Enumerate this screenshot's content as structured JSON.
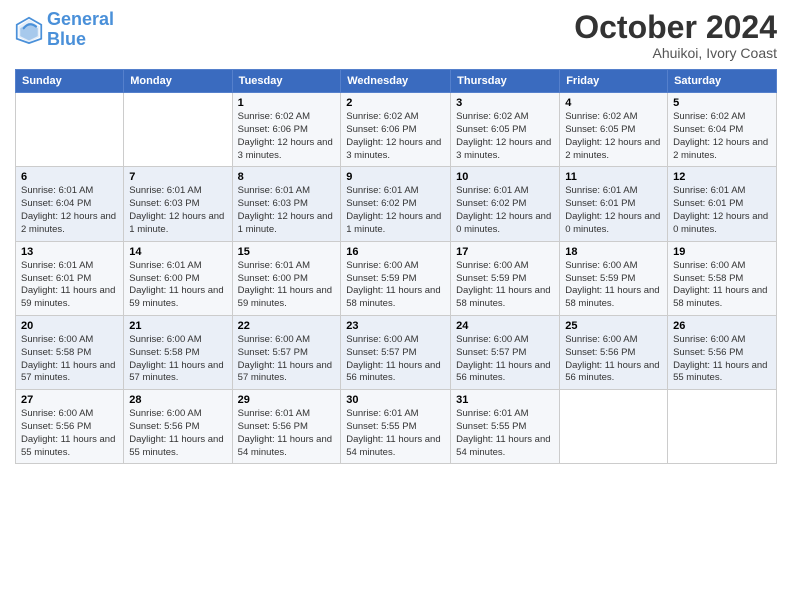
{
  "logo": {
    "line1": "General",
    "line2": "Blue"
  },
  "title": "October 2024",
  "subtitle": "Ahuikoi, Ivory Coast",
  "days_of_week": [
    "Sunday",
    "Monday",
    "Tuesday",
    "Wednesday",
    "Thursday",
    "Friday",
    "Saturday"
  ],
  "weeks": [
    [
      {
        "day": "",
        "info": ""
      },
      {
        "day": "",
        "info": ""
      },
      {
        "day": "1",
        "info": "Sunrise: 6:02 AM\nSunset: 6:06 PM\nDaylight: 12 hours and 3 minutes."
      },
      {
        "day": "2",
        "info": "Sunrise: 6:02 AM\nSunset: 6:06 PM\nDaylight: 12 hours and 3 minutes."
      },
      {
        "day": "3",
        "info": "Sunrise: 6:02 AM\nSunset: 6:05 PM\nDaylight: 12 hours and 3 minutes."
      },
      {
        "day": "4",
        "info": "Sunrise: 6:02 AM\nSunset: 6:05 PM\nDaylight: 12 hours and 2 minutes."
      },
      {
        "day": "5",
        "info": "Sunrise: 6:02 AM\nSunset: 6:04 PM\nDaylight: 12 hours and 2 minutes."
      }
    ],
    [
      {
        "day": "6",
        "info": "Sunrise: 6:01 AM\nSunset: 6:04 PM\nDaylight: 12 hours and 2 minutes."
      },
      {
        "day": "7",
        "info": "Sunrise: 6:01 AM\nSunset: 6:03 PM\nDaylight: 12 hours and 1 minute."
      },
      {
        "day": "8",
        "info": "Sunrise: 6:01 AM\nSunset: 6:03 PM\nDaylight: 12 hours and 1 minute."
      },
      {
        "day": "9",
        "info": "Sunrise: 6:01 AM\nSunset: 6:02 PM\nDaylight: 12 hours and 1 minute."
      },
      {
        "day": "10",
        "info": "Sunrise: 6:01 AM\nSunset: 6:02 PM\nDaylight: 12 hours and 0 minutes."
      },
      {
        "day": "11",
        "info": "Sunrise: 6:01 AM\nSunset: 6:01 PM\nDaylight: 12 hours and 0 minutes."
      },
      {
        "day": "12",
        "info": "Sunrise: 6:01 AM\nSunset: 6:01 PM\nDaylight: 12 hours and 0 minutes."
      }
    ],
    [
      {
        "day": "13",
        "info": "Sunrise: 6:01 AM\nSunset: 6:01 PM\nDaylight: 11 hours and 59 minutes."
      },
      {
        "day": "14",
        "info": "Sunrise: 6:01 AM\nSunset: 6:00 PM\nDaylight: 11 hours and 59 minutes."
      },
      {
        "day": "15",
        "info": "Sunrise: 6:01 AM\nSunset: 6:00 PM\nDaylight: 11 hours and 59 minutes."
      },
      {
        "day": "16",
        "info": "Sunrise: 6:00 AM\nSunset: 5:59 PM\nDaylight: 11 hours and 58 minutes."
      },
      {
        "day": "17",
        "info": "Sunrise: 6:00 AM\nSunset: 5:59 PM\nDaylight: 11 hours and 58 minutes."
      },
      {
        "day": "18",
        "info": "Sunrise: 6:00 AM\nSunset: 5:59 PM\nDaylight: 11 hours and 58 minutes."
      },
      {
        "day": "19",
        "info": "Sunrise: 6:00 AM\nSunset: 5:58 PM\nDaylight: 11 hours and 58 minutes."
      }
    ],
    [
      {
        "day": "20",
        "info": "Sunrise: 6:00 AM\nSunset: 5:58 PM\nDaylight: 11 hours and 57 minutes."
      },
      {
        "day": "21",
        "info": "Sunrise: 6:00 AM\nSunset: 5:58 PM\nDaylight: 11 hours and 57 minutes."
      },
      {
        "day": "22",
        "info": "Sunrise: 6:00 AM\nSunset: 5:57 PM\nDaylight: 11 hours and 57 minutes."
      },
      {
        "day": "23",
        "info": "Sunrise: 6:00 AM\nSunset: 5:57 PM\nDaylight: 11 hours and 56 minutes."
      },
      {
        "day": "24",
        "info": "Sunrise: 6:00 AM\nSunset: 5:57 PM\nDaylight: 11 hours and 56 minutes."
      },
      {
        "day": "25",
        "info": "Sunrise: 6:00 AM\nSunset: 5:56 PM\nDaylight: 11 hours and 56 minutes."
      },
      {
        "day": "26",
        "info": "Sunrise: 6:00 AM\nSunset: 5:56 PM\nDaylight: 11 hours and 55 minutes."
      }
    ],
    [
      {
        "day": "27",
        "info": "Sunrise: 6:00 AM\nSunset: 5:56 PM\nDaylight: 11 hours and 55 minutes."
      },
      {
        "day": "28",
        "info": "Sunrise: 6:00 AM\nSunset: 5:56 PM\nDaylight: 11 hours and 55 minutes."
      },
      {
        "day": "29",
        "info": "Sunrise: 6:01 AM\nSunset: 5:56 PM\nDaylight: 11 hours and 54 minutes."
      },
      {
        "day": "30",
        "info": "Sunrise: 6:01 AM\nSunset: 5:55 PM\nDaylight: 11 hours and 54 minutes."
      },
      {
        "day": "31",
        "info": "Sunrise: 6:01 AM\nSunset: 5:55 PM\nDaylight: 11 hours and 54 minutes."
      },
      {
        "day": "",
        "info": ""
      },
      {
        "day": "",
        "info": ""
      }
    ]
  ]
}
